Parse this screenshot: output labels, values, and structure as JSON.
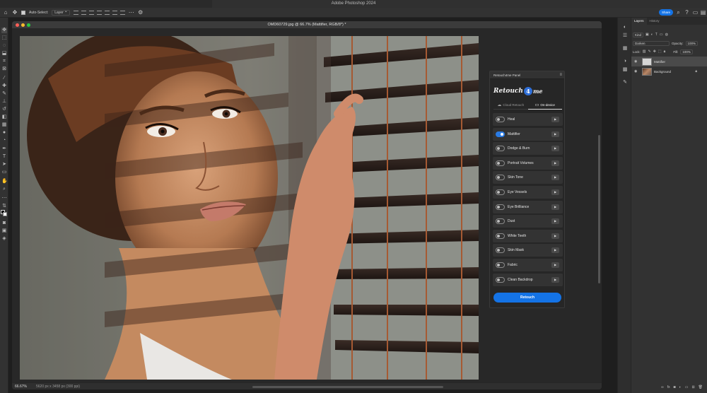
{
  "app": {
    "window_title": "Adobe Photoshop 2024"
  },
  "options_bar": {
    "auto_select_label": "Auto-Select:",
    "auto_select_value": "Layer",
    "share_label": "Share",
    "icons": [
      "home-icon",
      "move-tool-icon",
      "gear-icon",
      "search-icon",
      "help-icon",
      "workspace-icon",
      "panels-icon"
    ]
  },
  "document": {
    "tab_title": "OMD60729.jpg @ 66.7% (Mattifier, RGB/8*) *",
    "zoom": "66.67%",
    "doc_size": "5620 px x 3458 px (300 ppi)",
    "traffic_lights": [
      "#ff5f57",
      "#febc2e",
      "#28c840"
    ]
  },
  "plugin_panel": {
    "title": "Retouch4me Panel",
    "logo_text": "Retouch",
    "logo_badge": "4",
    "logo_tail": "me",
    "tabs": [
      {
        "label": "Cloud Retouch",
        "selected": false
      },
      {
        "label": "On-device",
        "selected": true
      }
    ],
    "tools": [
      {
        "label": "Heal",
        "on": false
      },
      {
        "label": "Mattifier",
        "on": true
      },
      {
        "label": "Dodge & Burn",
        "on": false
      },
      {
        "label": "Portrait Volumes",
        "on": false
      },
      {
        "label": "Skin Tone",
        "on": false
      },
      {
        "label": "Eye Vessels",
        "on": false
      },
      {
        "label": "Eye Brilliance",
        "on": false
      },
      {
        "label": "Dust",
        "on": false
      },
      {
        "label": "White Teeth",
        "on": false
      },
      {
        "label": "Skin Mask",
        "on": false
      },
      {
        "label": "Fabric",
        "on": false
      },
      {
        "label": "Clean Backdrop",
        "on": false
      }
    ],
    "retouch_label": "Retouch",
    "accent": "#1473e6"
  },
  "layers_panel": {
    "tabs": [
      {
        "label": "Layers",
        "selected": true
      },
      {
        "label": "History",
        "selected": false
      }
    ],
    "filter_value": "Kind",
    "blend_mode": "Darken",
    "opacity_label": "Opacity:",
    "opacity_value": "100%",
    "lock_label": "Lock:",
    "fill_label": "Fill:",
    "fill_value": "100%",
    "layers": [
      {
        "name": "Mattifier",
        "selected": true
      },
      {
        "name": "Background",
        "selected": false
      }
    ]
  }
}
